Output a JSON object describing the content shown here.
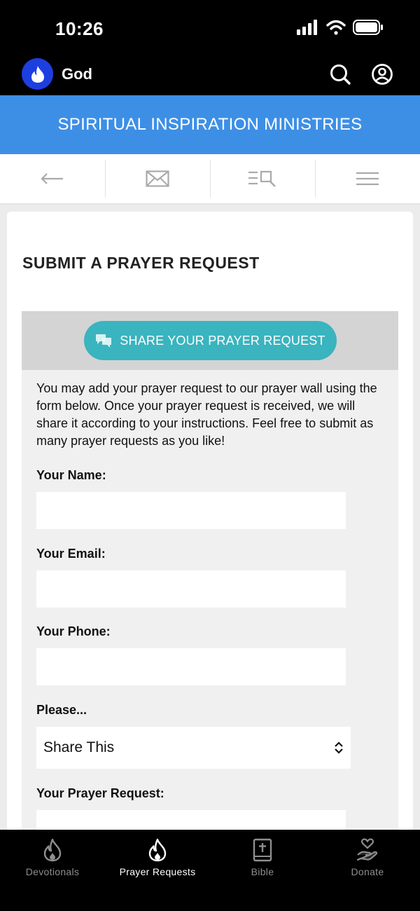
{
  "status_bar": {
    "time": "10:26"
  },
  "header": {
    "title": "God"
  },
  "banner": {
    "text": "SPIRITUAL INSPIRATION MINISTRIES"
  },
  "page": {
    "title": "SUBMIT A PRAYER REQUEST"
  },
  "form": {
    "share_button_label": "SHARE YOUR PRAYER REQUEST",
    "intro": "You may add your prayer request to our prayer wall using the form below. Once your prayer request is received, we will share it according to your instructions. Feel free to submit as many prayer requests as you like!",
    "name_label": "Your Name:",
    "email_label": "Your Email:",
    "phone_label": "Your Phone:",
    "please_label": "Please...",
    "please_selected": "Share This",
    "request_label": "Your Prayer Request:"
  },
  "tabs": [
    {
      "label": "Devotionals",
      "icon": "flame-outline-icon",
      "active": false
    },
    {
      "label": "Prayer Requests",
      "icon": "flame-icon",
      "active": true
    },
    {
      "label": "Bible",
      "icon": "bible-icon",
      "active": false
    },
    {
      "label": "Donate",
      "icon": "donate-heart-hand-icon",
      "active": false
    }
  ],
  "colors": {
    "banner": "#3d8fe6",
    "share_button": "#3ab4be",
    "logo": "#1d3fe0"
  }
}
